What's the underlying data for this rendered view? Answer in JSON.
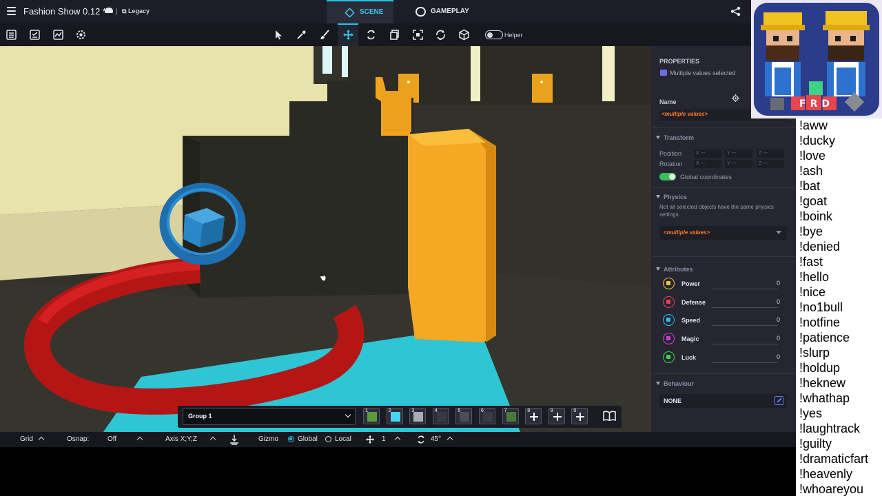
{
  "app": {
    "project_title": "Fashion Show 0.12 *",
    "mode_badge": "Legacy",
    "tabs": [
      {
        "label": "SCENE",
        "active": true
      },
      {
        "label": "GAMEPLAY",
        "active": false
      }
    ],
    "accent_color": "#29c2e8"
  },
  "toolbar": {
    "left_icons": [
      "list-icon",
      "checklist-icon",
      "chart-icon",
      "settings-gear-icon"
    ],
    "tools": [
      "select-arrow-icon",
      "eyedropper-icon",
      "brush-icon",
      "move-gizmo-icon",
      "rotate-icon",
      "duplicate-icon",
      "focus-icon",
      "refresh-camera-icon",
      "cube-icon"
    ],
    "active_tool": "move-gizmo-icon",
    "helper_label": "Helper",
    "helper_on": false
  },
  "hotbar": {
    "group_label": "Group 1",
    "slots": [
      {
        "num": "1",
        "color": "#5a9a3a"
      },
      {
        "num": "2",
        "color": "#48d4f0"
      },
      {
        "num": "3",
        "color": "#a9aab4"
      },
      {
        "num": "4",
        "color": "#3a3a42"
      },
      {
        "num": "5",
        "color": "#4a4c58"
      },
      {
        "num": "6",
        "color": "#3a3b44"
      },
      {
        "num": "7",
        "color": "#4a7a3a"
      },
      {
        "num": "8",
        "add": true
      },
      {
        "num": "9",
        "add": true
      },
      {
        "num": "0",
        "add": true
      }
    ]
  },
  "statusbar": {
    "grid_label": "Grid",
    "osnap_label": "Osnap:",
    "osnap_value": "Off",
    "axis_label": "Axis X;Y;Z",
    "gizmo_label": "Gizmo",
    "global_label": "Global",
    "local_label": "Local",
    "gizmo_space": "Global",
    "step_value": "1",
    "angle_value": "45°"
  },
  "properties": {
    "header": "PROPERTIES",
    "multi_selected": "Multiple values selected",
    "name_label": "Name",
    "name_value": "<multiple values>",
    "transform": {
      "header": "Transform",
      "position_label": "Position",
      "rotation_label": "Rotation",
      "x_placeholder": "X ---",
      "y_placeholder": "Y ---",
      "z_placeholder": "Z ---",
      "global_coords_label": "Global coordinates",
      "global_coords_on": true
    },
    "physics": {
      "header": "Physics",
      "note": "Not all selected objects have the same physics settings.",
      "value": "<multiple values>"
    },
    "attributes": {
      "header": "Attributes",
      "items": [
        {
          "label": "Power",
          "value": "0",
          "color": "#f2c230",
          "icon": "lightning-icon"
        },
        {
          "label": "Defense",
          "value": "0",
          "color": "#e8405a",
          "icon": "shield-icon"
        },
        {
          "label": "Speed",
          "value": "0",
          "color": "#35b8ea",
          "icon": "speed-icon"
        },
        {
          "label": "Magic",
          "value": "0",
          "color": "#d33ad6",
          "icon": "magic-icon"
        },
        {
          "label": "Luck",
          "value": "0",
          "color": "#3fd04a",
          "icon": "clover-icon"
        }
      ]
    },
    "behaviour": {
      "header": "Behaviour",
      "value": "NONE"
    }
  },
  "chat": [
    "!aww",
    "!ducky",
    "!love",
    "!ash",
    "!bat",
    "!goat",
    "!boink",
    "!bye",
    "!denied",
    "!fast",
    "!hello",
    "!nice",
    "!no1bull",
    "!notfine",
    "!patience",
    "!slurp",
    "!holdup",
    "!heknew",
    "!whathap",
    "!yes",
    "!laughtrack",
    "!guilty",
    "!dramaticfart",
    "!heavenly",
    "!whoareyou"
  ],
  "webcam_overlay_text": "FRD"
}
